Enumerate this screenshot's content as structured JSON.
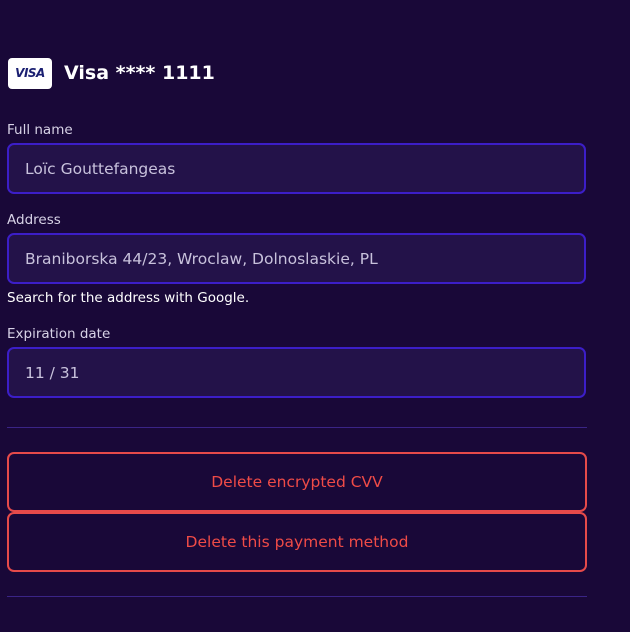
{
  "card": {
    "logo_text": "VISA",
    "title": "Visa **** 1111"
  },
  "form": {
    "full_name": {
      "label": "Full name",
      "value": "Loïc Gouttefangeas"
    },
    "address": {
      "label": "Address",
      "value": "Braniborska 44/23, Wroclaw, Dolnoslaskie, PL",
      "helper": "Search for the address with Google."
    },
    "expiration": {
      "label": "Expiration date",
      "value": "11 / 31"
    }
  },
  "actions": {
    "delete_cvv": "Delete encrypted CVV",
    "delete_method": "Delete this payment method"
  },
  "colors": {
    "background": "#190838",
    "input_background": "#231249",
    "input_border": "#3c1ec8",
    "danger": "#e64a4a",
    "divider": "#3a2486"
  }
}
